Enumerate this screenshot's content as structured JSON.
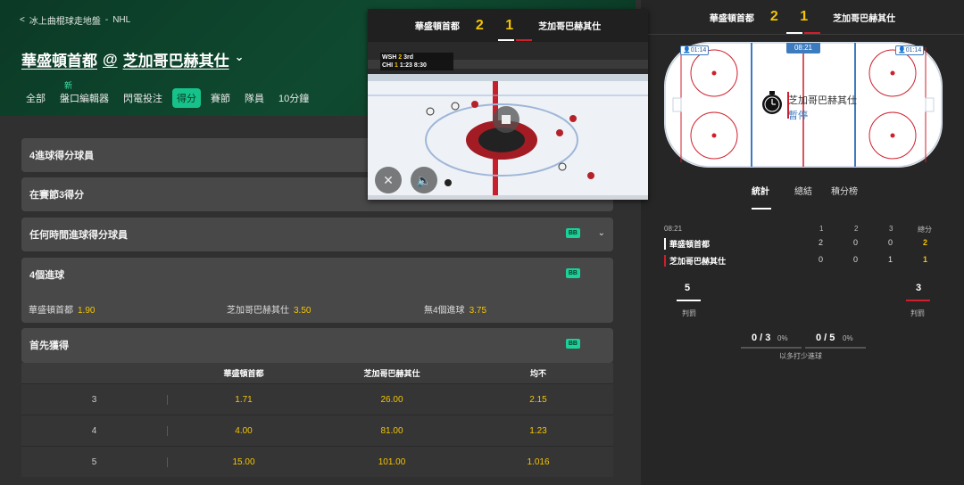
{
  "breadcrumb": {
    "back": "<",
    "sport": "冰上曲棍球走地盤",
    "sep": "-",
    "league": "NHL"
  },
  "match": {
    "home": "華盛頓首都",
    "at": "@",
    "away": "芝加哥巴赫其仕",
    "chevron": "⌄"
  },
  "tabs": [
    {
      "label": "全部"
    },
    {
      "label": "盤口編輯器",
      "badge": "新"
    },
    {
      "label": "閃電投注"
    },
    {
      "label": "得分",
      "active": true
    },
    {
      "label": "賽節"
    },
    {
      "label": "隊員"
    },
    {
      "label": "10分鐘"
    }
  ],
  "markets": {
    "m1": {
      "title": "4進球得分球員"
    },
    "m2": {
      "title": "在賽節3得分"
    },
    "m3": {
      "title": "任何時間進球得分球員",
      "badge": "BB"
    },
    "m4": {
      "title": "4個進球",
      "badge": "BB",
      "options": [
        {
          "label": "華盛頓首都",
          "odds": "1.90"
        },
        {
          "label": "芝加哥巴赫其仕",
          "odds": "3.50"
        },
        {
          "label": "無4個進球",
          "odds": "3.75"
        }
      ]
    },
    "m5": {
      "title": "首先獲得",
      "badge": "BB",
      "columns": [
        "",
        "華盛頓首都",
        "芝加哥巴赫其仕",
        "均不"
      ],
      "rows": [
        [
          "3",
          "1.71",
          "26.00",
          "2.15"
        ],
        [
          "4",
          "4.00",
          "81.00",
          "1.23"
        ],
        [
          "5",
          "15.00",
          "101.00",
          "1.016"
        ]
      ]
    }
  },
  "video": {
    "home": "華盛頓首都",
    "away": "芝加哥巴赫其仕",
    "score": "2 1",
    "overlay": {
      "home_abbr": "WSH",
      "away_abbr": "CHI",
      "home_score": "2",
      "away_score": "1",
      "period": "3rd",
      "time": "1:23",
      "clock2": "8:30"
    }
  },
  "right": {
    "home": "華盛頓首都",
    "away": "芝加哥巴赫其仕",
    "score": "2 1",
    "clock": "08:21",
    "pen_left": "01:14",
    "pen_right": "01:14",
    "status_team": "芝加哥巴赫其仕",
    "status": "暫停",
    "tabs": [
      "統計",
      "總結",
      "積分榜"
    ],
    "stats": {
      "time": "08:21",
      "periods": [
        "1",
        "2",
        "3"
      ],
      "total_label": "總分",
      "rows": [
        {
          "team": "華盛頓首都",
          "p": [
            "2",
            "0",
            "0"
          ],
          "total": "2"
        },
        {
          "team": "芝加哥巴赫其仕",
          "p": [
            "0",
            "0",
            "1"
          ],
          "total": "1"
        }
      ],
      "pen_home": "5",
      "pen_away": "3",
      "pen_label": "判罰",
      "pp_home": "0 / 3",
      "pp_home_pct": "0%",
      "pp_away": "0 / 5",
      "pp_away_pct": "0%",
      "pp_label": "以多打少進球"
    }
  },
  "colors": {
    "accent": "#16c28a",
    "odds": "#f5c400",
    "home": "#ffffff",
    "away": "#d01f2c",
    "header": "#0f4a30"
  }
}
